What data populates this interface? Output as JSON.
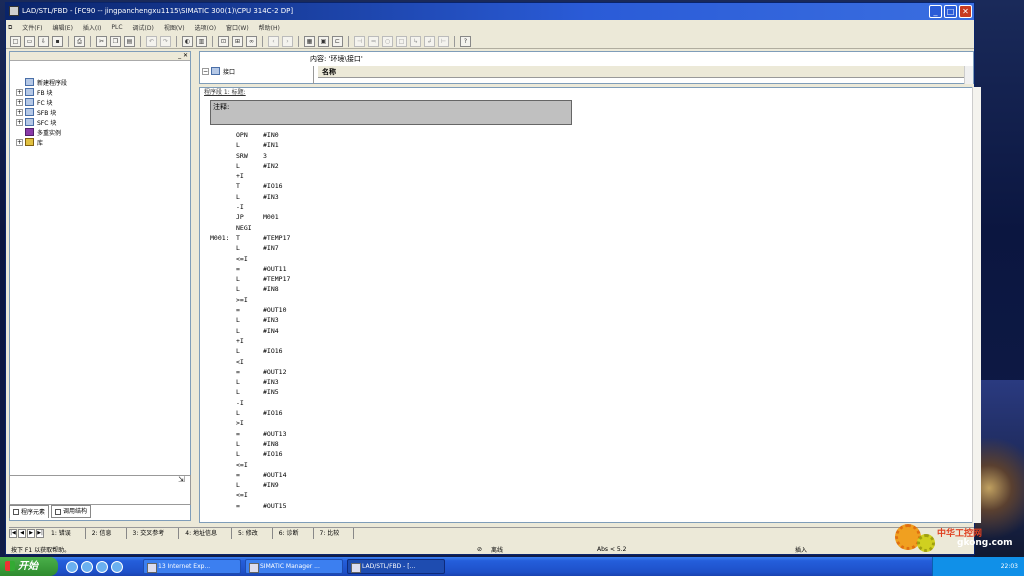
{
  "window": {
    "title": "LAD/STL/FBD  - [FC90 -- jingpanchengxu1115\\SIMATIC 300(1)\\CPU 314C-2 DP]"
  },
  "menu": [
    "文件(F)",
    "编辑(E)",
    "插入(I)",
    "PLC",
    "调试(D)",
    "视图(V)",
    "选项(O)",
    "窗口(W)",
    "帮助(H)"
  ],
  "left_tree": [
    {
      "label": "新建程序段",
      "expand": "",
      "icon": "network-icon"
    },
    {
      "label": "FB 块",
      "expand": "+",
      "icon": "fb-block-icon"
    },
    {
      "label": "FC 块",
      "expand": "+",
      "icon": "fc-block-icon"
    },
    {
      "label": "SFB 块",
      "expand": "+",
      "icon": "sfb-block-icon"
    },
    {
      "label": "SFC 块",
      "expand": "+",
      "icon": "sfc-block-icon"
    },
    {
      "label": "多重实例",
      "expand": "",
      "icon": "multi-instance-icon"
    },
    {
      "label": "库",
      "expand": "+",
      "icon": "library-icon"
    }
  ],
  "left_tabs": [
    "程序元素",
    "调用结构"
  ],
  "interface": {
    "content_label": "内容: '环境\\接口'",
    "node": "接口",
    "name_header": "名称"
  },
  "network": {
    "header": "程序段 1: 标题:",
    "comment": "注释:"
  },
  "code": [
    {
      "label": "",
      "op": "OPN",
      "arg": "#IN0"
    },
    {
      "label": "",
      "op": "L",
      "arg": "#IN1"
    },
    {
      "label": "",
      "op": "SRW",
      "arg": "3"
    },
    {
      "label": "",
      "op": "L",
      "arg": "#IN2"
    },
    {
      "label": "",
      "op": "+I",
      "arg": ""
    },
    {
      "label": "",
      "op": "T",
      "arg": "#IO16"
    },
    {
      "label": "",
      "op": "L",
      "arg": "#IN3"
    },
    {
      "label": "",
      "op": "-I",
      "arg": ""
    },
    {
      "label": "",
      "op": "JP",
      "arg": "M001"
    },
    {
      "label": "",
      "op": "NEGI",
      "arg": ""
    },
    {
      "label": "M001:",
      "op": "T",
      "arg": "#TEMP17"
    },
    {
      "label": "",
      "op": "L",
      "arg": "#IN7"
    },
    {
      "label": "",
      "op": "<=I",
      "arg": ""
    },
    {
      "label": "",
      "op": "=",
      "arg": "#OUT11"
    },
    {
      "label": "",
      "op": "L",
      "arg": "#TEMP17"
    },
    {
      "label": "",
      "op": "L",
      "arg": "#IN8"
    },
    {
      "label": "",
      "op": ">=I",
      "arg": ""
    },
    {
      "label": "",
      "op": "=",
      "arg": "#OUT10"
    },
    {
      "label": "",
      "op": "L",
      "arg": "#IN3"
    },
    {
      "label": "",
      "op": "L",
      "arg": "#IN4"
    },
    {
      "label": "",
      "op": "+I",
      "arg": ""
    },
    {
      "label": "",
      "op": "L",
      "arg": "#IO16"
    },
    {
      "label": "",
      "op": "<I",
      "arg": ""
    },
    {
      "label": "",
      "op": "=",
      "arg": "#OUT12"
    },
    {
      "label": "",
      "op": "L",
      "arg": "#IN3"
    },
    {
      "label": "",
      "op": "L",
      "arg": "#IN5"
    },
    {
      "label": "",
      "op": "-I",
      "arg": ""
    },
    {
      "label": "",
      "op": "L",
      "arg": "#IO16"
    },
    {
      "label": "",
      "op": ">I",
      "arg": ""
    },
    {
      "label": "",
      "op": "=",
      "arg": "#OUT13"
    },
    {
      "label": "",
      "op": "L",
      "arg": "#IN8"
    },
    {
      "label": "",
      "op": "L",
      "arg": "#IO16"
    },
    {
      "label": "",
      "op": "<=I",
      "arg": ""
    },
    {
      "label": "",
      "op": "=",
      "arg": "#OUT14"
    },
    {
      "label": "",
      "op": "L",
      "arg": "#IN9"
    },
    {
      "label": "",
      "op": "<=I",
      "arg": ""
    },
    {
      "label": "",
      "op": "=",
      "arg": "#OUT15"
    }
  ],
  "bottom_tabs": [
    "1: 错误",
    "2: 信息",
    "3: 交叉参考",
    "4: 地址信息",
    "5: 修改",
    "6: 诊断",
    "7: 比较"
  ],
  "status": {
    "help": "按下 F1 以获取帮助。",
    "mode": "离线",
    "position": "Abs < 5.2",
    "insert": "插入"
  },
  "taskbar": {
    "start": "开始",
    "tasks": [
      "13 Internet Exp...",
      "SIMATIC Manager ...",
      "LAD/STL/FBD - [..."
    ],
    "clock": "22:03"
  },
  "watermark": {
    "line1": "中华工控网",
    "line2": "gkong.com"
  }
}
